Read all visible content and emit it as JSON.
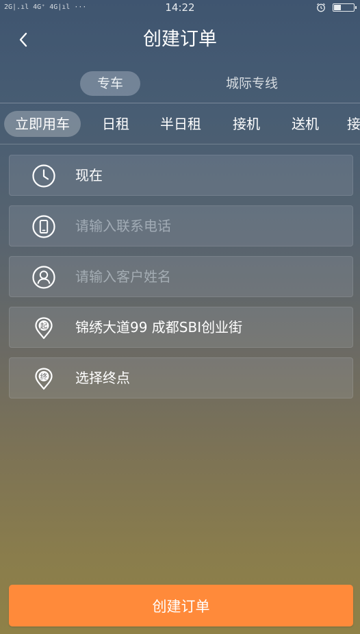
{
  "status_bar": {
    "signal_text": "2G|.ıl 4G⁺ 4G|ıl ···",
    "time": "14:22"
  },
  "header": {
    "title": "创建订单"
  },
  "top_tabs": [
    {
      "label": "专车",
      "active": true
    },
    {
      "label": "城际专线",
      "active": false
    }
  ],
  "sub_tabs": [
    {
      "label": "立即用车",
      "active": true
    },
    {
      "label": "日租",
      "active": false
    },
    {
      "label": "半日租",
      "active": false
    },
    {
      "label": "接机",
      "active": false
    },
    {
      "label": "送机",
      "active": false
    },
    {
      "label": "接",
      "active": false
    }
  ],
  "form": {
    "time": {
      "value": "现在",
      "icon": "clock-icon"
    },
    "phone": {
      "placeholder": "请输入联系电话",
      "icon": "phone-icon"
    },
    "name": {
      "placeholder": "请输入客户姓名",
      "icon": "user-icon"
    },
    "start": {
      "value": "锦绣大道99  成都SBI创业街",
      "icon": "start-pin-icon",
      "pin_label": "起"
    },
    "end": {
      "value": "选择终点",
      "icon": "end-pin-icon",
      "pin_label": "终"
    }
  },
  "submit": {
    "label": "创建订单"
  },
  "colors": {
    "accent": "#ff8a3a"
  }
}
